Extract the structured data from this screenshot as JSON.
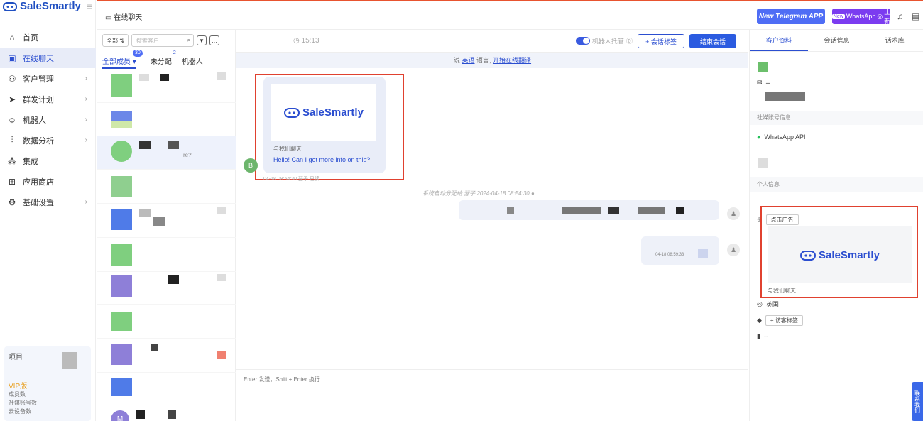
{
  "app": {
    "brand": "SaleSmartly"
  },
  "nav": {
    "items": [
      {
        "label": "首页",
        "icon": "home-icon"
      },
      {
        "label": "在线聊天",
        "icon": "chat-icon",
        "active": true
      },
      {
        "label": "客户管理",
        "icon": "users-icon"
      },
      {
        "label": "群发计划",
        "icon": "send-icon"
      },
      {
        "label": "机器人",
        "icon": "robot-icon"
      },
      {
        "label": "数据分析",
        "icon": "chart-icon"
      },
      {
        "label": "集成",
        "icon": "integration-icon"
      },
      {
        "label": "应用商店",
        "icon": "apps-icon"
      },
      {
        "label": "基础设置",
        "icon": "settings-icon"
      }
    ]
  },
  "project": {
    "title": "项目",
    "vip": "VIP版",
    "stats": [
      "成员数",
      "社媒账号数",
      "云设备数"
    ]
  },
  "topbar": {
    "breadcrumb": "在线聊天",
    "telegram_label": "New Telegram APP",
    "whatsapp_new": "New",
    "whatsapp_label": "WhatsApp",
    "whatsapp_badge": "上新"
  },
  "list": {
    "filter_all": "全部",
    "search_placeholder": "搜索客户",
    "tabs": [
      {
        "label": "全部成员",
        "badge": "30",
        "active": true
      },
      {
        "label": "未分配",
        "badge": "2"
      },
      {
        "label": "机器人"
      }
    ],
    "row_snippet": "re?",
    "row_m": "M"
  },
  "chat": {
    "time": "15:13",
    "robot_toggle": "机器人托管",
    "add_tag": "+ 会话标签",
    "end_chat": "结束会话",
    "lang_prefix": "说",
    "lang_link": "英语",
    "lang_mid": "语言,",
    "translate_link": "开始在线翻译",
    "msg_brand": "SaleSmartly",
    "msg_caption": "与我们聊天",
    "msg_link": "Hello! Can I get more info on this?",
    "msg_meta": "04-18 08:54:30  瑟子  已读",
    "avatar_letter": "B",
    "system_msg": "系统自动分配给 瑟子 2024-04-18 08:54:30",
    "out_time": "04-18 08:59:33",
    "input_placeholder": "Enter 发送，Shift + Enter 换行"
  },
  "right": {
    "tabs": [
      "客户资料",
      "会话信息",
      "话术库"
    ],
    "email": "--",
    "social_section": "社媒账号信息",
    "whatsapp_api": "WhatsApp API",
    "personal_section": "个人信息",
    "ad_chip": "点击广告",
    "ad_brand": "SaleSmartly",
    "ad_caption": "与我们聊天",
    "country": "英国",
    "visitor_tag": "+ 访客标签",
    "note": "--",
    "contact": "联系我们"
  }
}
